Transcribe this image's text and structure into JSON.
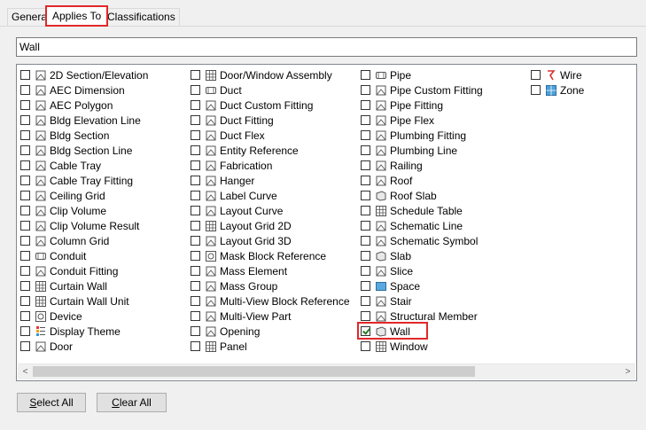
{
  "tabs": [
    {
      "label": "General",
      "active": false
    },
    {
      "label": "Applies To",
      "active": true
    },
    {
      "label": "Classifications",
      "active": false
    }
  ],
  "filter": {
    "value": "Wall"
  },
  "list": {
    "columns": [
      [
        {
          "label": "2D Section/Elevation",
          "icon": "section-elevation-icon",
          "checked": false
        },
        {
          "label": "AEC Dimension",
          "icon": "dimension-icon",
          "checked": false
        },
        {
          "label": "AEC Polygon",
          "icon": "polygon-icon",
          "checked": false
        },
        {
          "label": "Bldg Elevation Line",
          "icon": "elevation-line-icon",
          "checked": false
        },
        {
          "label": "Bldg Section",
          "icon": "bldg-section-icon",
          "checked": false
        },
        {
          "label": "Bldg Section Line",
          "icon": "section-line-icon",
          "checked": false
        },
        {
          "label": "Cable Tray",
          "icon": "cable-tray-icon",
          "checked": false
        },
        {
          "label": "Cable Tray Fitting",
          "icon": "cable-tray-fitting-icon",
          "checked": false
        },
        {
          "label": "Ceiling Grid",
          "icon": "ceiling-grid-icon",
          "checked": false
        },
        {
          "label": "Clip Volume",
          "icon": "clip-volume-icon",
          "checked": false
        },
        {
          "label": "Clip Volume Result",
          "icon": "clip-volume-result-icon",
          "checked": false
        },
        {
          "label": "Column Grid",
          "icon": "column-grid-icon",
          "checked": false
        },
        {
          "label": "Conduit",
          "icon": "conduit-icon",
          "checked": false
        },
        {
          "label": "Conduit Fitting",
          "icon": "conduit-fitting-icon",
          "checked": false
        },
        {
          "label": "Curtain Wall",
          "icon": "curtain-wall-icon",
          "checked": false
        },
        {
          "label": "Curtain Wall Unit",
          "icon": "curtain-wall-unit-icon",
          "checked": false
        },
        {
          "label": "Device",
          "icon": "device-icon",
          "checked": false
        },
        {
          "label": "Display Theme",
          "icon": "display-theme-icon",
          "checked": false
        },
        {
          "label": "Door",
          "icon": "door-icon",
          "checked": false
        }
      ],
      [
        {
          "label": "Door/Window Assembly",
          "icon": "door-window-assembly-icon",
          "checked": false
        },
        {
          "label": "Duct",
          "icon": "duct-icon",
          "checked": false
        },
        {
          "label": "Duct Custom Fitting",
          "icon": "duct-custom-fitting-icon",
          "checked": false
        },
        {
          "label": "Duct Fitting",
          "icon": "duct-fitting-icon",
          "checked": false
        },
        {
          "label": "Duct Flex",
          "icon": "duct-flex-icon",
          "checked": false
        },
        {
          "label": "Entity Reference",
          "icon": "entity-reference-icon",
          "checked": false
        },
        {
          "label": "Fabrication",
          "icon": "fabrication-icon",
          "checked": false
        },
        {
          "label": "Hanger",
          "icon": "hanger-icon",
          "checked": false
        },
        {
          "label": "Label Curve",
          "icon": "label-curve-icon",
          "checked": false
        },
        {
          "label": "Layout Curve",
          "icon": "layout-curve-icon",
          "checked": false
        },
        {
          "label": "Layout Grid 2D",
          "icon": "layout-grid-2d-icon",
          "checked": false
        },
        {
          "label": "Layout Grid 3D",
          "icon": "layout-grid-3d-icon",
          "checked": false
        },
        {
          "label": "Mask Block Reference",
          "icon": "mask-block-icon",
          "checked": false
        },
        {
          "label": "Mass Element",
          "icon": "mass-element-icon",
          "checked": false
        },
        {
          "label": "Mass Group",
          "icon": "mass-group-icon",
          "checked": false
        },
        {
          "label": "Multi-View Block Reference",
          "icon": "mvblock-reference-icon",
          "checked": false
        },
        {
          "label": "Multi-View Part",
          "icon": "mvpart-icon",
          "checked": false
        },
        {
          "label": "Opening",
          "icon": "opening-icon",
          "checked": false
        },
        {
          "label": "Panel",
          "icon": "panel-icon",
          "checked": false
        }
      ],
      [
        {
          "label": "Pipe",
          "icon": "pipe-icon",
          "checked": false
        },
        {
          "label": "Pipe Custom Fitting",
          "icon": "pipe-custom-fitting-icon",
          "checked": false
        },
        {
          "label": "Pipe Fitting",
          "icon": "pipe-fitting-icon",
          "checked": false
        },
        {
          "label": "Pipe Flex",
          "icon": "pipe-flex-icon",
          "checked": false
        },
        {
          "label": "Plumbing Fitting",
          "icon": "plumbing-fitting-icon",
          "checked": false
        },
        {
          "label": "Plumbing Line",
          "icon": "plumbing-line-icon",
          "checked": false
        },
        {
          "label": "Railing",
          "icon": "railing-icon",
          "checked": false
        },
        {
          "label": "Roof",
          "icon": "roof-icon",
          "checked": false
        },
        {
          "label": "Roof Slab",
          "icon": "roof-slab-icon",
          "checked": false
        },
        {
          "label": "Schedule Table",
          "icon": "schedule-table-icon",
          "checked": false
        },
        {
          "label": "Schematic Line",
          "icon": "schematic-line-icon",
          "checked": false
        },
        {
          "label": "Schematic Symbol",
          "icon": "schematic-symbol-icon",
          "checked": false
        },
        {
          "label": "Slab",
          "icon": "slab-icon",
          "checked": false
        },
        {
          "label": "Slice",
          "icon": "slice-icon",
          "checked": false
        },
        {
          "label": "Space",
          "icon": "space-icon",
          "checked": false
        },
        {
          "label": "Stair",
          "icon": "stair-icon",
          "checked": false
        },
        {
          "label": "Structural Member",
          "icon": "structural-member-icon",
          "checked": false
        },
        {
          "label": "Wall",
          "icon": "wall-icon",
          "checked": true,
          "highlight": true
        },
        {
          "label": "Window",
          "icon": "window-icon",
          "checked": false
        }
      ],
      [
        {
          "label": "Wire",
          "icon": "wire-icon",
          "checked": false
        },
        {
          "label": "Zone",
          "icon": "zone-icon",
          "checked": false
        }
      ]
    ]
  },
  "scrollbar": {
    "left_arrow": "<",
    "right_arrow": ">"
  },
  "buttons": {
    "select_all": {
      "mnemonic": "S",
      "rest": "elect All"
    },
    "clear_all": {
      "mnemonic": "C",
      "rest": "lear All"
    }
  },
  "colors": {
    "highlight": "#e0282a",
    "check": "#2a7a2a",
    "zone": "#4ea0d8",
    "wire": "#d8322e"
  }
}
